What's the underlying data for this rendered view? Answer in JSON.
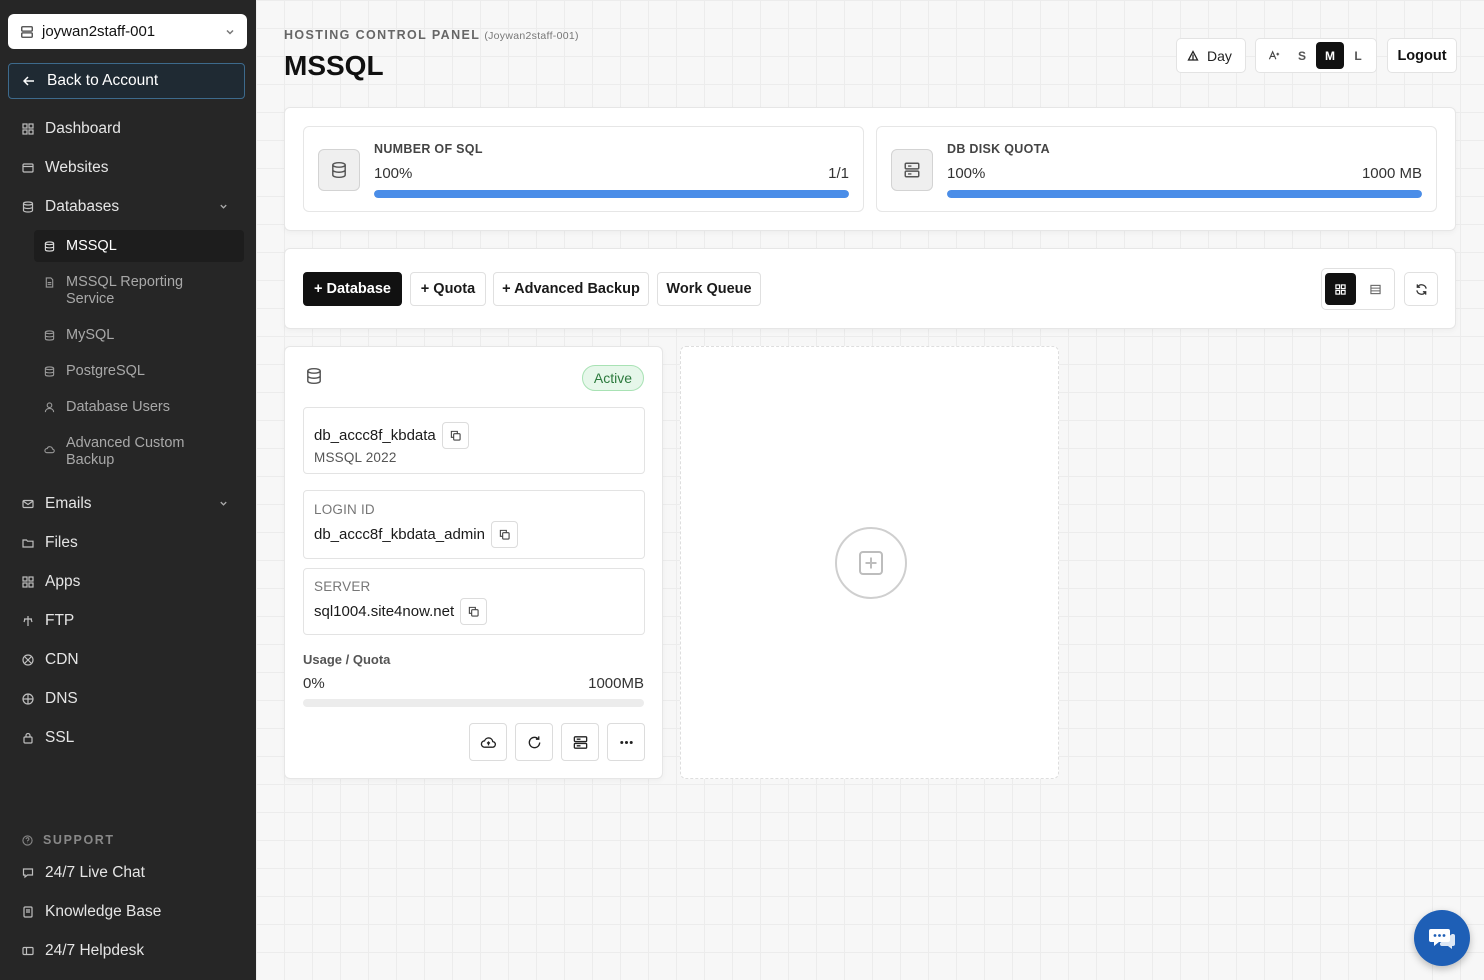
{
  "sidebar": {
    "account": "joywan2staff-001",
    "back": "Back to Account",
    "items": {
      "dashboard": "Dashboard",
      "websites": "Websites",
      "databases": "Databases",
      "emails": "Emails",
      "files": "Files",
      "apps": "Apps",
      "ftp": "FTP",
      "cdn": "CDN",
      "dns": "DNS",
      "ssl": "SSL"
    },
    "db_sub": {
      "mssql": "MSSQL",
      "mssql_reporting": "MSSQL Reporting Service",
      "mysql": "MySQL",
      "postgresql": "PostgreSQL",
      "db_users": "Database Users",
      "adv_backup": "Advanced Custom Backup"
    },
    "support": {
      "title": "SUPPORT",
      "live_chat": "24/7 Live Chat",
      "kb": "Knowledge Base",
      "helpdesk": "24/7 Helpdesk"
    }
  },
  "header": {
    "crumb": "HOSTING CONTROL PANEL",
    "crumb_sub": "(Joywan2staff-001)",
    "title": "MSSQL",
    "day": "Day",
    "sizes": {
      "s": "S",
      "m": "M",
      "l": "L"
    },
    "logout": "Logout"
  },
  "stats": {
    "sql": {
      "label": "NUMBER OF SQL",
      "pct": "100%",
      "value": "1/1",
      "fill": 100
    },
    "disk": {
      "label": "DB DISK QUOTA",
      "pct": "100%",
      "value": "1000 MB",
      "fill": 100
    }
  },
  "actions": {
    "add_db": "+ Database",
    "add_quota": "+ Quota",
    "adv_backup": "+ Advanced Backup",
    "work_queue": "Work Queue"
  },
  "db_card": {
    "status": "Active",
    "name": "db_accc8f_kbdata",
    "version": "MSSQL 2022",
    "login_label": "LOGIN ID",
    "login": "db_accc8f_kbdata_admin",
    "server_label": "SERVER",
    "server": "sql1004.site4now.net",
    "usage_label": "Usage / Quota",
    "usage_pct": "0%",
    "usage_quota": "1000MB",
    "usage_fill": 0
  },
  "colors": {
    "accent": "#4a8de8",
    "sidebar": "#262626",
    "active_badge": "#e6f7ea",
    "fab": "#1e5fb6"
  }
}
